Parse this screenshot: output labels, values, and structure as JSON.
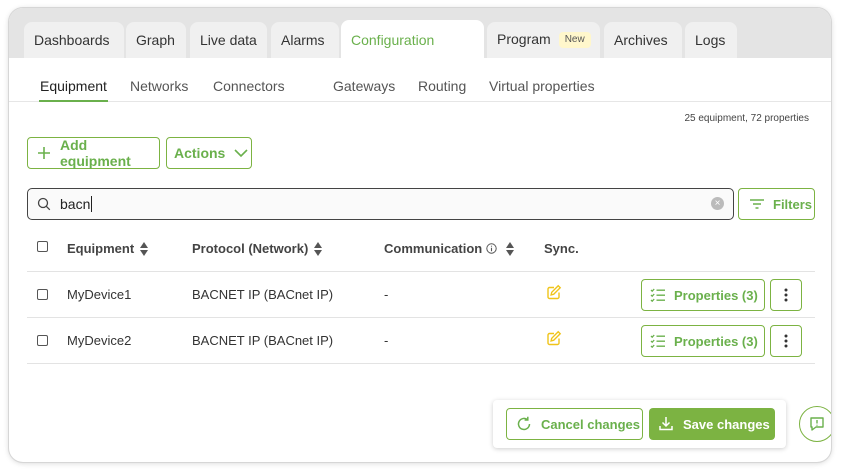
{
  "tabs": [
    {
      "label": "Dashboards"
    },
    {
      "label": "Graph"
    },
    {
      "label": "Live data"
    },
    {
      "label": "Alarms"
    },
    {
      "label": "Configuration",
      "active": true
    },
    {
      "label": "Program",
      "badge": "New"
    },
    {
      "label": "Archives"
    },
    {
      "label": "Logs"
    }
  ],
  "subtabs": [
    {
      "label": "Equipment",
      "active": true
    },
    {
      "label": "Networks"
    },
    {
      "label": "Connectors"
    },
    {
      "label": "Gateways"
    },
    {
      "label": "Routing"
    },
    {
      "label": "Virtual properties"
    }
  ],
  "summary": "25 equipment, 72 properties",
  "toolbar": {
    "add_label": "Add equipment",
    "actions_label": "Actions"
  },
  "search": {
    "value": "bacn",
    "filters_label": "Filters"
  },
  "table": {
    "headers": {
      "equipment": "Equipment",
      "protocol": "Protocol (Network)",
      "communication": "Communication",
      "sync": "Sync."
    },
    "rows": [
      {
        "name": "MyDevice1",
        "protocol": "BACNET IP (BACnet IP)",
        "communication": "-",
        "properties_label": "Properties (3)"
      },
      {
        "name": "MyDevice2",
        "protocol": "BACNET IP (BACnet IP)",
        "communication": "-",
        "properties_label": "Properties (3)"
      }
    ]
  },
  "footer": {
    "cancel_label": "Cancel changes",
    "save_label": "Save changes"
  },
  "colors": {
    "accent": "#7cb342",
    "sync_icon": "#f0c419",
    "badge_bg": "#fff7cc"
  },
  "icons": [
    "plus-icon",
    "chevron-down-icon",
    "search-icon",
    "clear-icon",
    "filter-icon",
    "sort-icon",
    "info-icon",
    "edit-icon",
    "list-check-icon",
    "kebab-icon",
    "refresh-icon",
    "download-icon",
    "chat-help-icon"
  ]
}
